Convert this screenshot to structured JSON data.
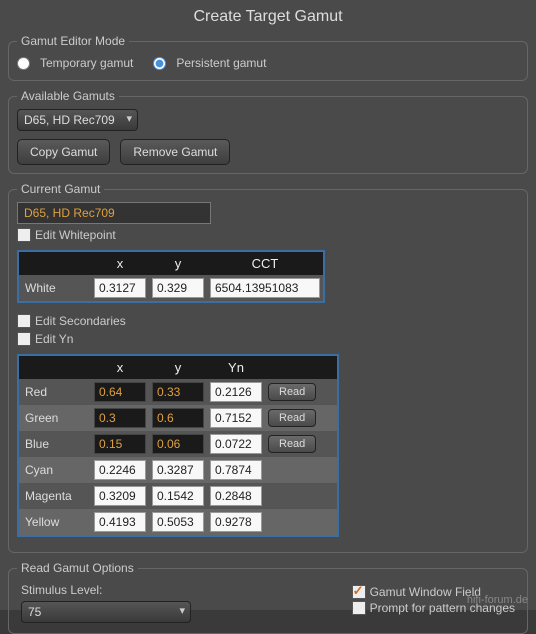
{
  "title": "Create Target Gamut",
  "editor_mode": {
    "legend": "Gamut Editor Mode",
    "temporary_label": "Temporary gamut",
    "persistent_label": "Persistent gamut",
    "selected": "persistent"
  },
  "available": {
    "legend": "Available Gamuts",
    "selected": "D65, HD Rec709",
    "copy_label": "Copy Gamut",
    "remove_label": "Remove Gamut"
  },
  "current": {
    "legend": "Current Gamut",
    "name": "D65, HD Rec709",
    "edit_whitepoint": "Edit Whitepoint",
    "edit_secondaries": "Edit Secondaries",
    "edit_yn": "Edit Yn",
    "white_table": {
      "cols": {
        "x": "x",
        "y": "y",
        "cct": "CCT"
      },
      "row_label": "White",
      "x": "0.3127",
      "y": "0.329",
      "cct": "6504.13951083"
    },
    "color_table": {
      "cols": {
        "x": "x",
        "y": "y",
        "yn": "Yn"
      },
      "read_label": "Read",
      "rows": [
        {
          "label": "Red",
          "x": "0.64",
          "y": "0.33",
          "yn": "0.2126",
          "editable": true,
          "read": true
        },
        {
          "label": "Green",
          "x": "0.3",
          "y": "0.6",
          "yn": "0.7152",
          "editable": true,
          "read": true
        },
        {
          "label": "Blue",
          "x": "0.15",
          "y": "0.06",
          "yn": "0.0722",
          "editable": true,
          "read": true
        },
        {
          "label": "Cyan",
          "x": "0.2246",
          "y": "0.3287",
          "yn": "0.7874",
          "editable": false,
          "read": false
        },
        {
          "label": "Magenta",
          "x": "0.3209",
          "y": "0.1542",
          "yn": "0.2848",
          "editable": false,
          "read": false
        },
        {
          "label": "Yellow",
          "x": "0.4193",
          "y": "0.5053",
          "yn": "0.9278",
          "editable": false,
          "read": false
        }
      ]
    }
  },
  "read_options": {
    "legend": "Read Gamut Options",
    "stimulus_label": "Stimulus Level:",
    "stimulus_value": "75",
    "gamut_window_field": "Gamut Window Field",
    "prompt_pattern": "Prompt for pattern changes"
  },
  "watermark": "hifi-forum.de"
}
